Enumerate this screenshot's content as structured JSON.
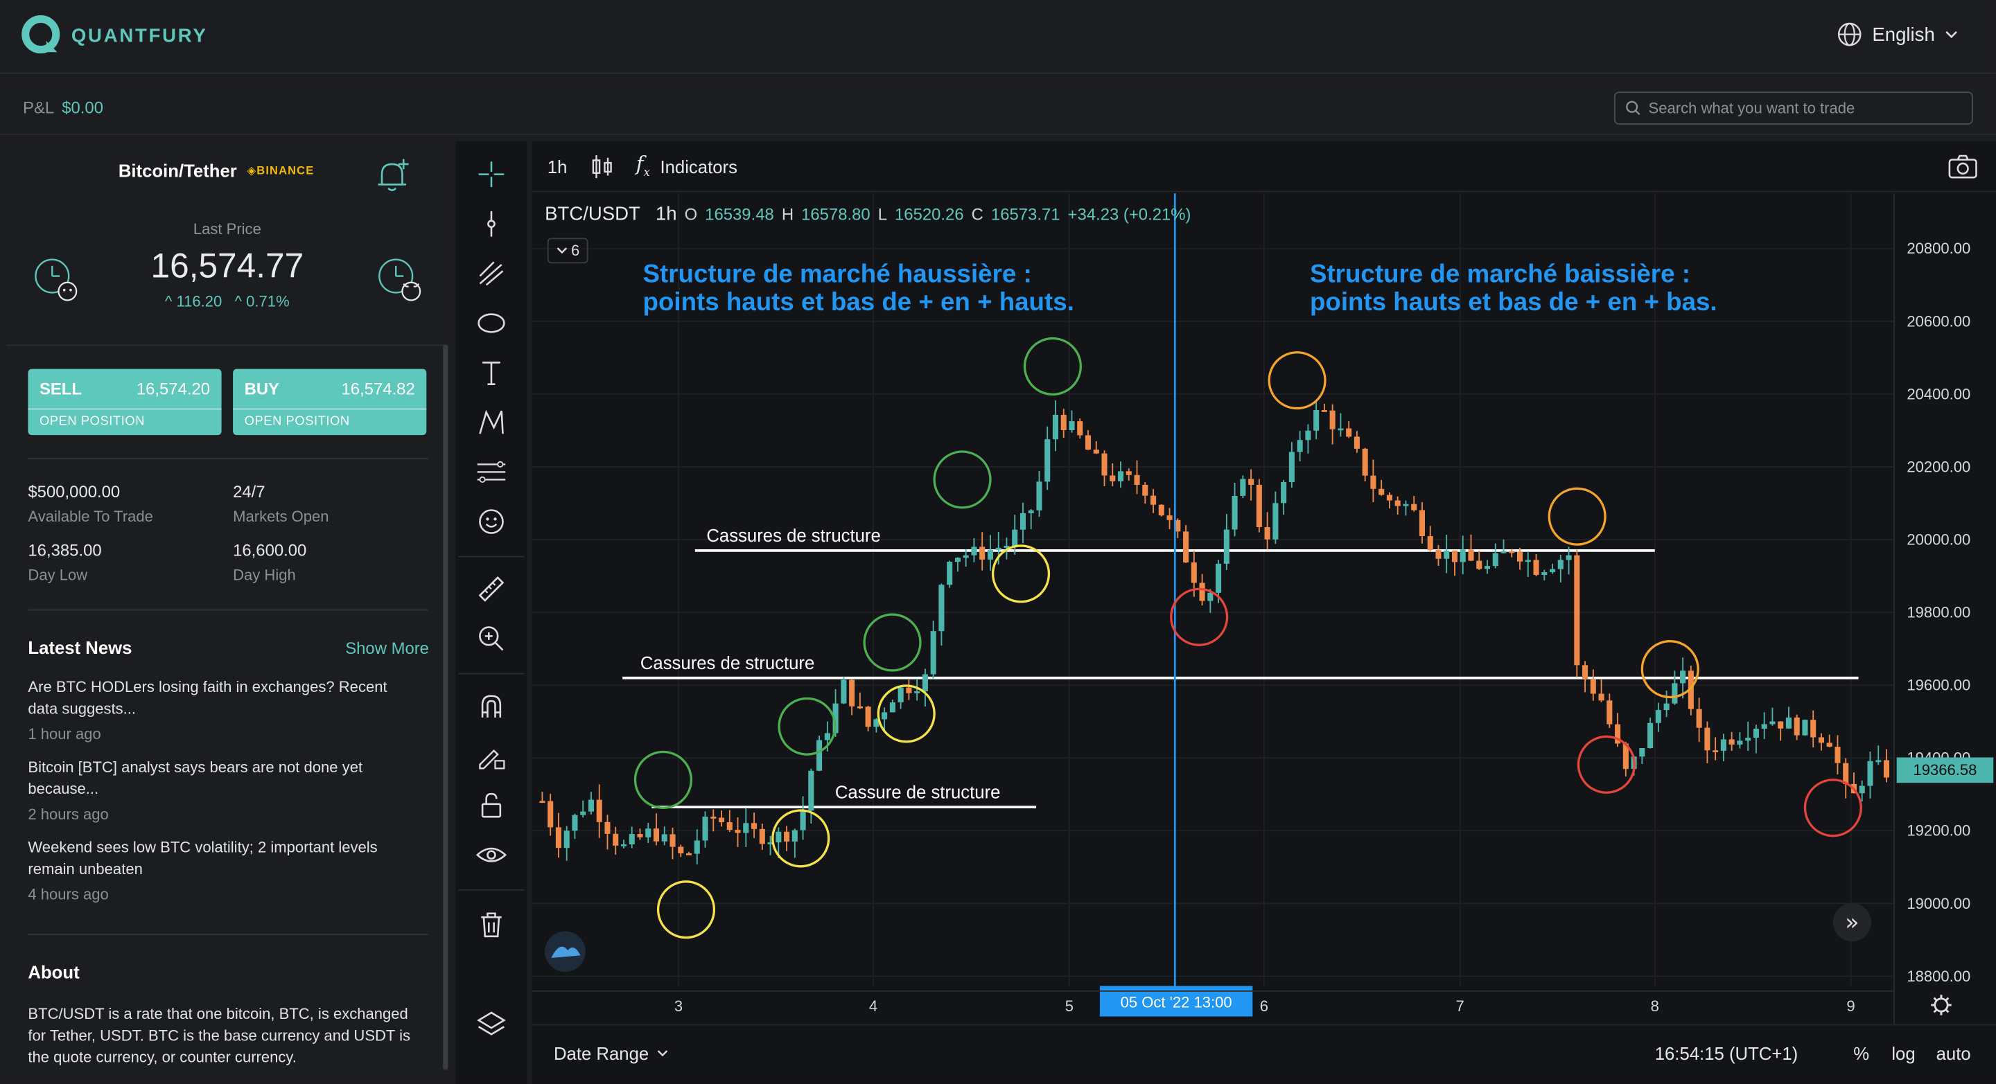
{
  "app": {
    "brand": "QUANTFURY",
    "language": "English",
    "brand_color": "#5ec8bd"
  },
  "subbar": {
    "pnl_label": "P&L",
    "pnl_value": "$0.00",
    "search_placeholder": "Search what you want to trade"
  },
  "instrument": {
    "name": "Bitcoin/Tether",
    "exchange": "BINANCE",
    "last_price_label": "Last Price",
    "last_price": "16,574.77",
    "change_abs": "116.20",
    "change_pct": "0.71%"
  },
  "trade": {
    "sell": {
      "label": "SELL",
      "price": "16,574.20",
      "sub": "OPEN POSITION"
    },
    "buy": {
      "label": "BUY",
      "price": "16,574.82",
      "sub": "OPEN POSITION"
    }
  },
  "stats": [
    {
      "value": "$500,000.00",
      "label": "Available To Trade"
    },
    {
      "value": "24/7",
      "label": "Markets Open"
    },
    {
      "value": "16,385.00",
      "label": "Day Low"
    },
    {
      "value": "16,600.00",
      "label": "Day High"
    }
  ],
  "news": {
    "title": "Latest News",
    "more": "Show More",
    "items": [
      {
        "headline": "Are BTC HODLers losing faith in exchanges? Recent data suggests...",
        "time": "1 hour ago"
      },
      {
        "headline": "Bitcoin [BTC] analyst says bears are not done yet because...",
        "time": "2 hours ago"
      },
      {
        "headline": "Weekend sees low BTC volatility; 2 important levels remain unbeaten",
        "time": "4 hours ago"
      }
    ]
  },
  "about": {
    "title": "About",
    "text": "BTC/USDT is a rate that one bitcoin, BTC, is exchanged for Tether, USDT. BTC is the base currency and USDT is the quote currency, or counter currency."
  },
  "toolbar": {
    "interval": "1h",
    "indicators": "Indicators"
  },
  "legend": {
    "symbol": "BTC/USDT",
    "interval": "1h",
    "o_label": "O",
    "o": "16539.48",
    "h_label": "H",
    "h": "16578.80",
    "l_label": "L",
    "l": "16520.26",
    "c_label": "C",
    "c": "16573.71",
    "change": "+34.23 (+0.21%)",
    "layers_count": "6"
  },
  "bottom": {
    "date_range": "Date Range",
    "clock": "16:54:15 (UTC+1)",
    "pct": "%",
    "log": "log",
    "auto": "auto"
  },
  "chart_data": {
    "type": "candlestick",
    "symbol": "BTC/USDT",
    "x_ticks": [
      "3",
      "4",
      "5",
      "6",
      "7",
      "8",
      "9"
    ],
    "crosshair_label": "05 Oct '22   13:00",
    "y_ticks": [
      20800,
      20600,
      20400,
      20200,
      20000,
      19800,
      19600,
      19400,
      19200,
      19000,
      18800
    ],
    "y_tick_labels": [
      "20800.00",
      "20600.00",
      "20400.00",
      "20200.00",
      "20000.00",
      "19800.00",
      "19600.00",
      "19400.00",
      "19200.00",
      "19000.00",
      "18800.00"
    ],
    "ylim": [
      18750,
      20950
    ],
    "last_value": "19366.58",
    "annotation_left": [
      "Structure de marché haussière :",
      "points hauts et bas de + en + hauts."
    ],
    "annotation_right": [
      "Structure de marché baissière :",
      "points hauts et bas de + en + bas."
    ],
    "structure_lines": [
      {
        "label": "Cassure de structure",
        "price": 19265
      },
      {
        "label": "Cassures de structure",
        "price": 19620
      },
      {
        "label": "Cassures de structure",
        "price": 19970
      }
    ],
    "colors": {
      "up": "#4db6ac",
      "down": "#f08a48",
      "annotation": "#2196f3"
    }
  }
}
